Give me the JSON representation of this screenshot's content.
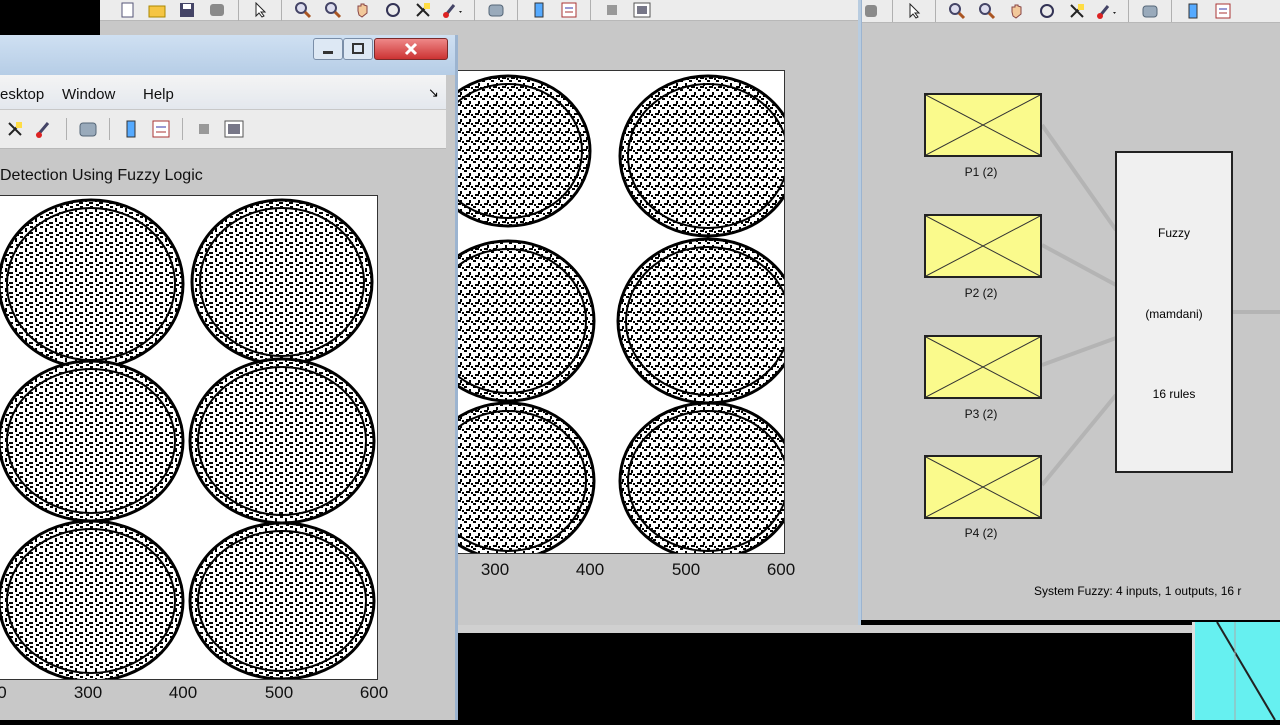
{
  "left_window": {
    "menu": [
      "esktop",
      "Window",
      "Help"
    ],
    "figure_title": "Detection Using Fuzzy Logic",
    "x_ticks": [
      "0",
      "300",
      "400",
      "500",
      "600"
    ]
  },
  "middle_window": {
    "x_ticks": [
      "300",
      "400",
      "500",
      "600"
    ]
  },
  "fis_editor": {
    "inputs": [
      {
        "label": "P1 (2)"
      },
      {
        "label": "P2 (2)"
      },
      {
        "label": "P3 (2)"
      },
      {
        "label": "P4 (2)"
      }
    ],
    "system_box": {
      "name": "Fuzzy",
      "type": "(mamdani)",
      "rules": "16 rules"
    },
    "status": "System Fuzzy: 4 inputs, 1 outputs, 16 r"
  },
  "colors": {
    "figure_bg": "#c0c0c0",
    "input_box": "#fafa8c",
    "system_box": "#f0f0f0",
    "cyan_panel": "#66f0f0"
  },
  "icons": [
    "new-file-icon",
    "open-folder-icon",
    "save-icon",
    "print-icon",
    "pointer-icon",
    "zoom-in-icon",
    "zoom-out-icon",
    "pan-hand-icon",
    "rotate-icon",
    "data-cursor-icon",
    "brush-icon",
    "link-icon",
    "colorbar-icon",
    "legend-icon",
    "hide-tools-icon",
    "show-tools-icon"
  ]
}
